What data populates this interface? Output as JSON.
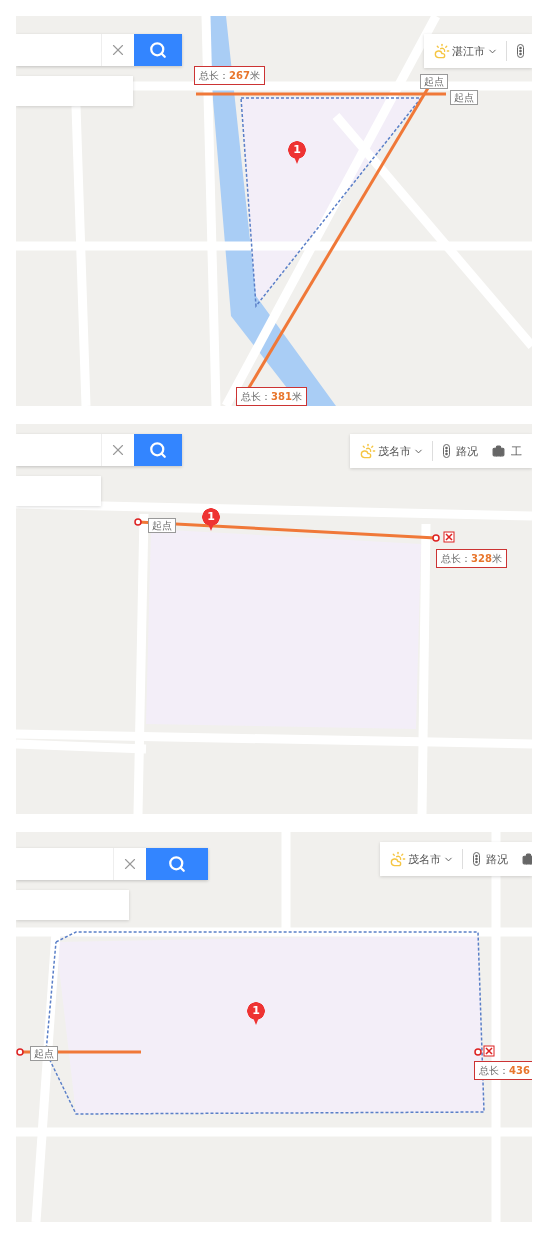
{
  "panels": [
    {
      "city": "湛江市",
      "toolbar_items": [
        {
          "kind": "traffic"
        }
      ],
      "pin": "1",
      "start_labels": [
        "起点",
        "起点"
      ],
      "totals": [
        {
          "label": "总长：",
          "value": "267",
          "unit": "米"
        },
        {
          "label": "总长：",
          "value": "381",
          "unit": "米"
        }
      ]
    },
    {
      "city": "茂名市",
      "toolbar_items": [
        {
          "kind": "traffic",
          "label": "路况"
        },
        {
          "kind": "tools",
          "label": "工"
        }
      ],
      "pin": "1",
      "start_labels": [
        "起点"
      ],
      "totals": [
        {
          "label": "总长：",
          "value": "328",
          "unit": "米"
        }
      ]
    },
    {
      "city": "茂名市",
      "toolbar_items": [
        {
          "kind": "traffic",
          "label": "路况"
        },
        {
          "kind": "tools"
        }
      ],
      "pin": "1",
      "start_labels": [
        "起点"
      ],
      "totals": [
        {
          "label": "总长：",
          "value": "436"
        }
      ]
    }
  ]
}
